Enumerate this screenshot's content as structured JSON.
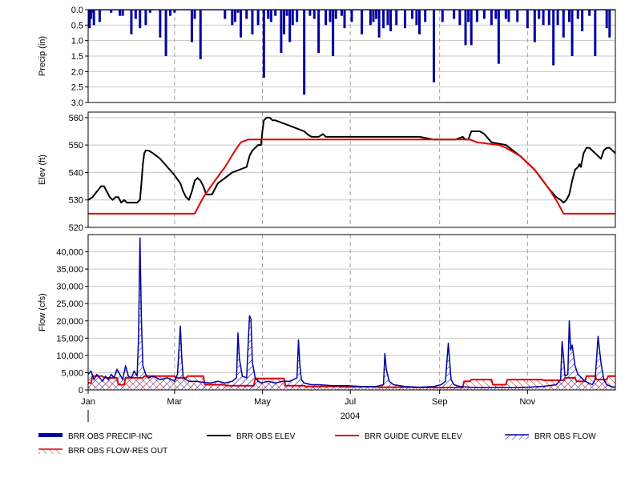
{
  "chart_data": [
    {
      "type": "bar",
      "panel": "precip",
      "ylabel": "Precip (in)",
      "ylim": [
        0,
        3
      ],
      "y_inverted": true,
      "yticks": [
        "0.0",
        "0.5",
        "1.0",
        "1.5",
        "2.0",
        "2.5",
        "3.0"
      ],
      "grid": true,
      "series": [
        {
          "name": "BRR OBS PRECIP-INC",
          "color": "#0000a0",
          "x_day": [
            1,
            2,
            3,
            4,
            8,
            16,
            22,
            24,
            30,
            33,
            36,
            40,
            43,
            50,
            54,
            57,
            60,
            72,
            74,
            78,
            95,
            100,
            102,
            104,
            106,
            110,
            114,
            118,
            122,
            125,
            127,
            130,
            134,
            136,
            138,
            140,
            142,
            145,
            150,
            154,
            157,
            160,
            165,
            168,
            170,
            172,
            176,
            178,
            183,
            190,
            196,
            198,
            200,
            202,
            205,
            208,
            210,
            214,
            220,
            225,
            228,
            230,
            234,
            240,
            246,
            254,
            258,
            262,
            264,
            266,
            270,
            275,
            280,
            283,
            285,
            290,
            292,
            298,
            305,
            310,
            313,
            316,
            320,
            323,
            326,
            330,
            334,
            336,
            340,
            343,
            348,
            352,
            360,
            362
          ],
          "values": [
            0.6,
            0.3,
            0.1,
            0.5,
            0.4,
            0.1,
            0.2,
            0.2,
            0.8,
            0.3,
            0.6,
            0.5,
            0.1,
            0.9,
            1.5,
            0.2,
            0.1,
            1.05,
            0.3,
            1.6,
            0.3,
            0.5,
            0.4,
            0.1,
            0.9,
            0.3,
            0.8,
            0.5,
            2.2,
            0.3,
            0.4,
            0.2,
            1.4,
            0.8,
            0.2,
            1.05,
            0.5,
            0.4,
            2.75,
            0.2,
            0.3,
            1.4,
            0.5,
            0.4,
            1.5,
            0.3,
            0.2,
            0.6,
            0.4,
            0.8,
            0.5,
            0.4,
            0.3,
            0.9,
            0.6,
            0.5,
            0.7,
            0.5,
            0.6,
            0.3,
            0.5,
            0.8,
            0.4,
            2.35,
            0.4,
            0.3,
            0.5,
            1.15,
            0.4,
            1.15,
            0.4,
            0.3,
            0.5,
            0.3,
            1.75,
            0.3,
            0.4,
            0.4,
            0.6,
            1.05,
            0.3,
            0.5,
            0.5,
            1.8,
            0.5,
            0.9,
            0.4,
            1.5,
            0.3,
            0.7,
            0.2,
            1.5,
            0.6,
            0.9,
            1.95,
            0.3
          ]
        }
      ]
    },
    {
      "type": "line",
      "panel": "elev",
      "ylabel": "Elev (ft)",
      "ylim": [
        520,
        562
      ],
      "yticks": [
        "520",
        "530",
        "540",
        "550",
        "560"
      ],
      "grid": true,
      "series": [
        {
          "name": "BRR OBS ELEV",
          "color": "#000000",
          "x_day": [
            0,
            3,
            6,
            9,
            11,
            13,
            15,
            17,
            19,
            21,
            23,
            25,
            27,
            29,
            32,
            34,
            36,
            37,
            38,
            39,
            40,
            42,
            45,
            50,
            55,
            60,
            64,
            66,
            68,
            70,
            72,
            74,
            76,
            78,
            80,
            82,
            84,
            86,
            88,
            90,
            95,
            100,
            105,
            110,
            111,
            112,
            114,
            116,
            118,
            120,
            121,
            122,
            124,
            126,
            128,
            130,
            135,
            140,
            145,
            150,
            152,
            155,
            158,
            160,
            163,
            165,
            170,
            180,
            190,
            200,
            210,
            220,
            230,
            240,
            250,
            255,
            260,
            262,
            264,
            266,
            268,
            270,
            272,
            275,
            280,
            290,
            300,
            310,
            320,
            325,
            328,
            330,
            332,
            334,
            336,
            338,
            340,
            341,
            342,
            344,
            346,
            348,
            350,
            352,
            354,
            356,
            358,
            360,
            362,
            364,
            366
          ],
          "values": [
            530,
            531,
            533,
            535,
            535,
            533,
            531,
            530,
            531,
            531,
            529,
            530,
            529,
            529,
            529,
            529,
            530,
            536,
            543,
            547,
            548,
            548,
            547,
            545,
            542,
            539,
            536,
            533,
            531,
            530,
            533,
            537,
            538,
            537,
            535,
            532,
            532,
            532,
            534,
            536,
            538,
            540,
            541,
            542,
            544,
            546,
            548,
            549,
            550,
            550,
            555,
            559,
            560,
            560,
            559,
            559,
            558,
            557,
            556,
            555,
            554,
            553,
            553,
            553,
            554,
            553,
            553,
            553,
            553,
            553,
            553,
            553,
            553,
            552,
            552,
            552,
            553,
            552,
            552,
            555,
            555,
            555,
            555,
            554,
            551,
            550,
            546,
            541,
            534,
            531,
            530,
            529,
            530,
            532,
            537,
            541,
            542,
            543,
            542,
            547,
            549,
            549,
            548,
            547,
            546,
            545,
            548,
            549,
            549,
            548,
            547
          ]
        },
        {
          "name": "BRR GUIDE CURVE ELEV",
          "color": "#e00000",
          "x_day": [
            0,
            74,
            80,
            88,
            95,
            102,
            106,
            111,
            115,
            120,
            130,
            150,
            200,
            250,
            265,
            270,
            285,
            290,
            300,
            310,
            320,
            326,
            330,
            366
          ],
          "values": [
            525,
            525,
            531,
            537,
            542,
            548,
            551,
            552,
            552,
            552,
            552,
            552,
            552,
            552,
            552,
            551,
            550,
            549,
            546,
            541,
            534,
            529,
            525,
            525
          ]
        }
      ]
    },
    {
      "type": "area",
      "panel": "flow",
      "ylabel": "Flow (cfs)",
      "ylim": [
        0,
        45000
      ],
      "yticks": [
        "0",
        "5,000",
        "10,000",
        "15,000",
        "20,000",
        "25,000",
        "30,000",
        "35,000",
        "40,000"
      ],
      "grid": true,
      "x_ticks": [
        {
          "label": "Jan",
          "day": 0
        },
        {
          "label": "Mar",
          "day": 60
        },
        {
          "label": "May",
          "day": 121
        },
        {
          "label": "Jul",
          "day": 182
        },
        {
          "label": "Sep",
          "day": 244
        },
        {
          "label": "Nov",
          "day": 305
        }
      ],
      "xlabel_year": "2004",
      "series": [
        {
          "name": "BRR OBS FLOW",
          "color": "#0000a0",
          "x_day": [
            0,
            2,
            4,
            6,
            8,
            10,
            12,
            14,
            16,
            18,
            20,
            22,
            24,
            26,
            28,
            30,
            32,
            34,
            35,
            36,
            37,
            38,
            40,
            42,
            45,
            50,
            55,
            58,
            60,
            62,
            64,
            65,
            66,
            68,
            70,
            75,
            80,
            85,
            90,
            95,
            100,
            103,
            104,
            105,
            107,
            110,
            112,
            113,
            114,
            116,
            118,
            120,
            125,
            130,
            135,
            140,
            145,
            146,
            147,
            148,
            150,
            155,
            160,
            170,
            180,
            190,
            200,
            205,
            206,
            207,
            209,
            212,
            220,
            230,
            240,
            245,
            248,
            250,
            251,
            252,
            254,
            258,
            265,
            275,
            285,
            295,
            305,
            315,
            325,
            328,
            329,
            330,
            331,
            333,
            334,
            335,
            336,
            338,
            340,
            345,
            350,
            352,
            354,
            356,
            358,
            360,
            363,
            366
          ],
          "values": [
            4500,
            5500,
            3000,
            4500,
            3500,
            2500,
            4000,
            3000,
            4500,
            3500,
            6000,
            4500,
            3000,
            7000,
            4000,
            3500,
            5500,
            4000,
            15000,
            44000,
            20000,
            7000,
            4500,
            3500,
            4000,
            3000,
            3500,
            3000,
            2500,
            4500,
            18500,
            9000,
            3500,
            3000,
            2500,
            2500,
            2200,
            2000,
            2500,
            2000,
            2500,
            3500,
            16500,
            9000,
            4000,
            3500,
            21500,
            20500,
            8000,
            3500,
            2500,
            2000,
            2500,
            2000,
            2500,
            2500,
            3500,
            14500,
            7000,
            3000,
            2000,
            1500,
            1500,
            1200,
            1200,
            1000,
            1000,
            1500,
            10500,
            6000,
            2500,
            1500,
            1000,
            800,
            1000,
            1500,
            2500,
            13500,
            8000,
            3000,
            1500,
            1000,
            800,
            700,
            800,
            700,
            800,
            1000,
            1500,
            3000,
            14000,
            9500,
            4000,
            4500,
            20000,
            11500,
            13000,
            7000,
            4500,
            2500,
            1500,
            3000,
            15500,
            8000,
            3000,
            1500,
            1000,
            800
          ]
        },
        {
          "name": "BRR OBS FLOW-RES OUT",
          "color": "#e00000",
          "x_day": [
            0,
            2,
            3,
            10,
            11,
            20,
            21,
            25,
            26,
            38,
            39,
            60,
            61,
            68,
            69,
            80,
            81,
            95,
            96,
            115,
            116,
            136,
            137,
            150,
            151,
            175,
            176,
            200,
            201,
            225,
            226,
            260,
            261,
            265,
            266,
            280,
            281,
            290,
            291,
            315,
            316,
            330,
            331,
            338,
            339,
            345,
            346,
            352,
            353,
            360,
            361,
            366
          ],
          "values": [
            2000,
            2000,
            4000,
            4000,
            3500,
            3500,
            1500,
            1500,
            3500,
            3500,
            4000,
            4000,
            3500,
            3500,
            4000,
            4000,
            1500,
            1500,
            1200,
            1200,
            3300,
            3300,
            1200,
            1200,
            1000,
            1000,
            900,
            900,
            800,
            800,
            700,
            700,
            2500,
            2500,
            3000,
            3000,
            1500,
            1500,
            3000,
            3000,
            2800,
            2800,
            3500,
            3500,
            2500,
            2500,
            4000,
            4000,
            3000,
            3000,
            4000,
            4000
          ]
        }
      ]
    }
  ],
  "legend": [
    {
      "name": "BRR OBS PRECIP-INC",
      "style": "thick-line",
      "color": "#0000a0"
    },
    {
      "name": "BRR OBS ELEV",
      "style": "line",
      "color": "#000000"
    },
    {
      "name": "BRR GUIDE CURVE ELEV",
      "style": "line",
      "color": "#e00000"
    },
    {
      "name": "BRR OBS FLOW",
      "style": "hatched-area",
      "color": "#0000a0"
    },
    {
      "name": "BRR OBS FLOW-RES OUT",
      "style": "hatched-area",
      "color": "#e00000"
    }
  ]
}
